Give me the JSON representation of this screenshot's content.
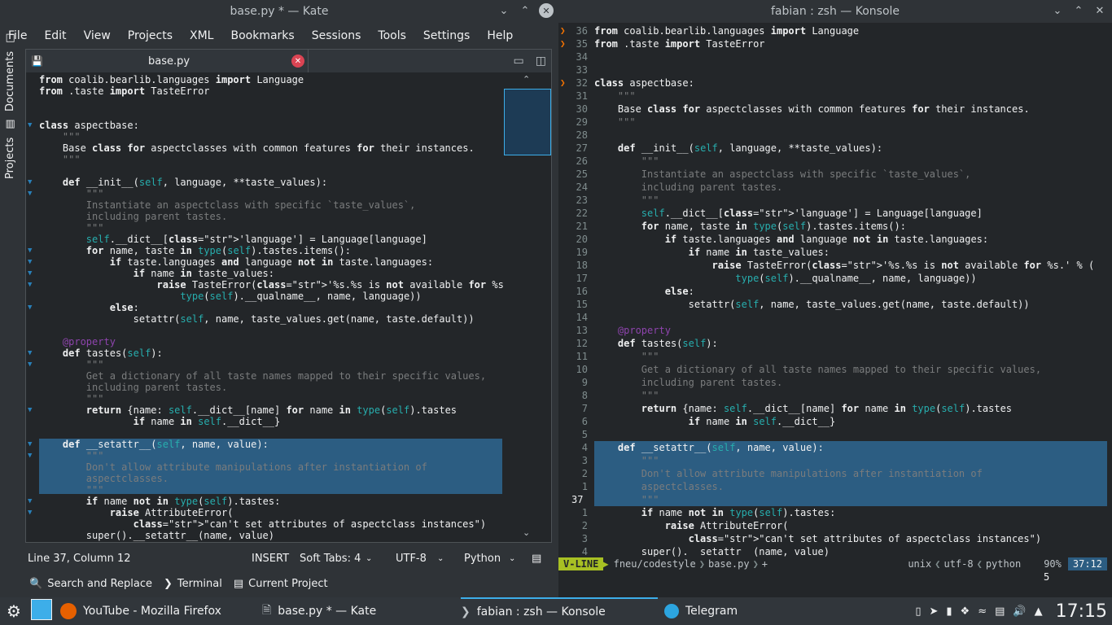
{
  "kate": {
    "title": "base.py * — Kate",
    "menu": [
      "File",
      "Edit",
      "View",
      "Projects",
      "XML",
      "Bookmarks",
      "Sessions",
      "Tools",
      "Settings",
      "Help"
    ],
    "sidebar_tabs": [
      "Documents",
      "Projects"
    ],
    "tab_title": "base.py",
    "status": {
      "position": "Line 37, Column 12",
      "mode": "INSERT",
      "tabs": "Soft Tabs: 4",
      "encoding": "UTF-8",
      "language": "Python"
    },
    "tools": [
      "Search and Replace",
      "Terminal",
      "Current Project"
    ]
  },
  "konsole": {
    "title": "fabian : zsh — Konsole",
    "status": {
      "mode": "V-LINE",
      "path": "fneu/codestyle",
      "file": "base.py",
      "modified": "+",
      "format": "unix",
      "encoding": "utf-8",
      "filetype": "python",
      "percent": "90%",
      "position": "37:12"
    },
    "extra": "5"
  },
  "taskbar": {
    "tasks": [
      "YouTube - Mozilla Firefox",
      "base.py * — Kate",
      "fabian : zsh — Konsole",
      "Telegram"
    ],
    "clock": "17:15"
  },
  "code": [
    "from coalib.bearlib.languages import Language",
    "from .taste import TasteError",
    "",
    "",
    "class aspectbase:",
    "    \"\"\"",
    "    Base class for aspectclasses with common features for their instances.",
    "    \"\"\"",
    "",
    "    def __init__(self, language, **taste_values):",
    "        \"\"\"",
    "        Instantiate an aspectclass with specific `taste_values`,",
    "        including parent tastes.",
    "        \"\"\"",
    "        self.__dict__['language'] = Language[language]",
    "        for name, taste in type(self).tastes.items():",
    "            if taste.languages and language not in taste.languages:",
    "                if name in taste_values:",
    "                    raise TasteError('%s.%s is not available for %s.' % (",
    "                        type(self).__qualname__, name, language))",
    "            else:",
    "                setattr(self, name, taste_values.get(name, taste.default))",
    "",
    "    @property",
    "    def tastes(self):",
    "        \"\"\"",
    "        Get a dictionary of all taste names mapped to their specific values,",
    "        including parent tastes.",
    "        \"\"\"",
    "        return {name: self.__dict__[name] for name in type(self).tastes",
    "                if name in self.__dict__}",
    "",
    "    def __setattr__(self, name, value):",
    "        \"\"\"",
    "        Don't allow attribute manipulations after instantiation of",
    "        aspectclasses.",
    "        \"\"\"",
    "        if name not in type(self).tastes:",
    "            raise AttributeError(",
    "                \"can't set attributes of aspectclass instances\")",
    "        super().__setattr__(name, value)"
  ],
  "konsole_code": [
    {
      "n": "36",
      "i": 0
    },
    {
      "n": "35",
      "i": 1
    },
    {
      "n": "34",
      "i": 2
    },
    {
      "n": "33",
      "i": 3
    },
    {
      "n": "32",
      "i": 4
    },
    {
      "n": "31",
      "i": 5
    },
    {
      "n": "30",
      "i": 6
    },
    {
      "n": "29",
      "i": 7
    },
    {
      "n": "28",
      "i": 8
    },
    {
      "n": "27",
      "i": 9
    },
    {
      "n": "26",
      "i": 10
    },
    {
      "n": "25",
      "i": 11
    },
    {
      "n": "24",
      "i": 12
    },
    {
      "n": "23",
      "i": 13
    },
    {
      "n": "22",
      "i": 14
    },
    {
      "n": "21",
      "i": 15
    },
    {
      "n": "20",
      "i": 16
    },
    {
      "n": "19",
      "i": 17
    },
    {
      "n": "18",
      "i": 18
    },
    {
      "n": "17",
      "i": 19
    },
    {
      "n": "16",
      "i": 20
    },
    {
      "n": "15",
      "i": 21
    },
    {
      "n": "14",
      "i": 22
    },
    {
      "n": "13",
      "i": 23
    },
    {
      "n": "12",
      "i": 24
    },
    {
      "n": "11",
      "i": 25
    },
    {
      "n": "10",
      "i": 26
    },
    {
      "n": "9",
      "i": 27
    },
    {
      "n": "8",
      "i": 28
    },
    {
      "n": "7",
      "i": 29
    },
    {
      "n": "6",
      "i": 30
    },
    {
      "n": "5",
      "i": 31
    },
    {
      "n": "4",
      "i": 32
    },
    {
      "n": "3",
      "i": 33
    },
    {
      "n": "2",
      "i": 34
    },
    {
      "n": "1",
      "i": 35
    },
    {
      "n": "37",
      "i": 36
    },
    {
      "n": "1",
      "i": 37
    },
    {
      "n": "2",
      "i": 38
    },
    {
      "n": "3",
      "i": 39
    },
    {
      "n": "4",
      "i": 40
    }
  ],
  "colors": {
    "accent": "#3daee9",
    "selection": "#2c5d82",
    "keyword": "#fdbc4b",
    "string": "#da4453",
    "self": "#27aeae",
    "vline": "#a8c023"
  }
}
